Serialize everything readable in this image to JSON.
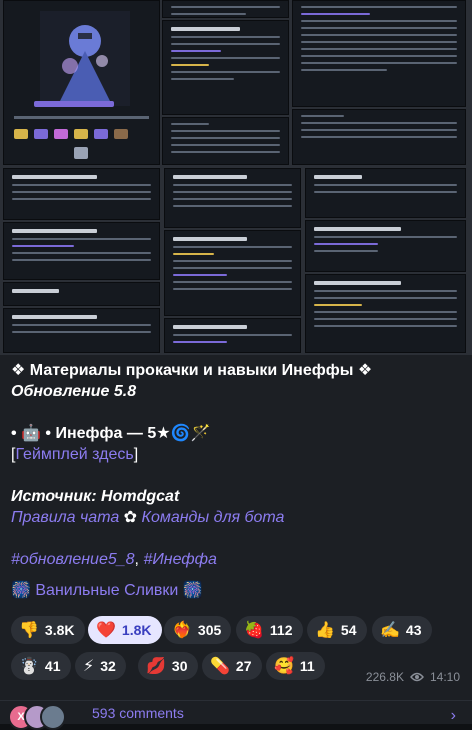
{
  "post": {
    "title": "❖ Материалы прокачки и навыки Инеффы ❖",
    "subtitle": "Обновление 5.8",
    "char_line": "• 🤖 • Инеффа — 5★🌀🪄",
    "gameplay_open": "[",
    "gameplay_link": "Геймплей здесь",
    "gameplay_close": "]",
    "source": "Источник: Homdgcat",
    "rules_link": "Правила чата",
    "rules_sep": " ✿ ",
    "commands_link": "Команды для бота",
    "hashtag1": "#обновление5_8",
    "hashtag_sep": ", ",
    "hashtag2": "#Инеффа",
    "signature": "🎆 Ванильные Сливки 🎆"
  },
  "reactions": [
    {
      "emoji": "👎",
      "count": "3.8K",
      "active": false
    },
    {
      "emoji": "❤️",
      "count": "1.8K",
      "active": true
    },
    {
      "emoji": "❤️‍🔥",
      "count": "305",
      "active": false
    },
    {
      "emoji": "🍓",
      "count": "112",
      "active": false
    },
    {
      "emoji": "👍",
      "count": "54",
      "active": false
    },
    {
      "emoji": "✍️",
      "count": "43",
      "active": false
    },
    {
      "emoji": "☃️",
      "count": "41",
      "active": false
    },
    {
      "emoji": "⚡",
      "count": "32",
      "active": false
    },
    {
      "emoji": "💋",
      "count": "30",
      "active": false
    },
    {
      "emoji": "💊",
      "count": "27",
      "active": false
    },
    {
      "emoji": "🥰",
      "count": "11",
      "active": false
    }
  ],
  "meta": {
    "views": "226.8K",
    "time": "14:10"
  },
  "comments": {
    "label": "593 comments",
    "avatar_initial": "X"
  },
  "colors": {
    "accent": "#8c7cf0",
    "bubble": "#1c1f24",
    "chip": "#2c3037",
    "chip_active": "#e6e6ff"
  }
}
